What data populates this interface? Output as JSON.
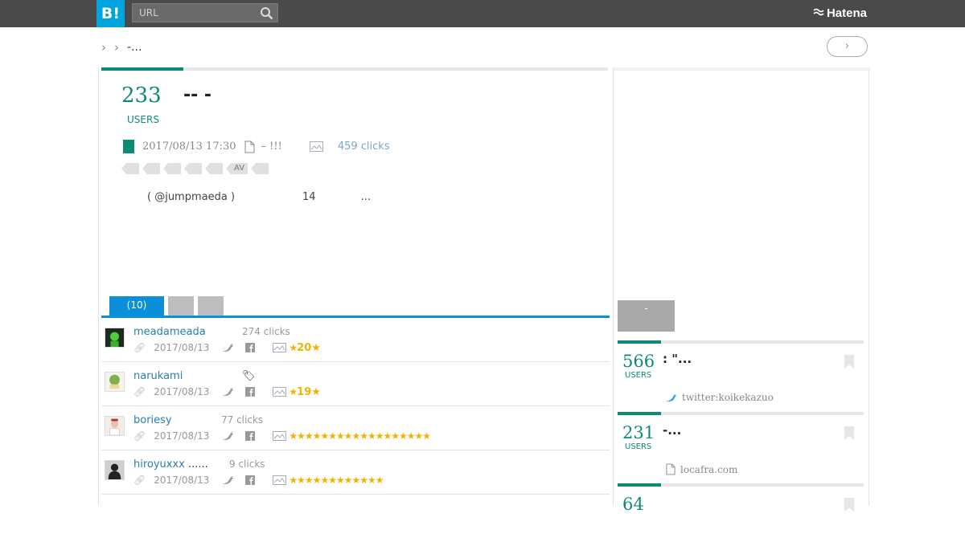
{
  "header": {
    "logo": "B!",
    "url_placeholder": "URL",
    "brand": "Hatena"
  },
  "breadcrumb": {
    "current": "-..."
  },
  "entry": {
    "users_count": "233",
    "users_label": "USERS",
    "title": "-- -",
    "date": "2017/08/13 17:30",
    "source": "– !!!",
    "clicks": "459 clicks",
    "tags": [
      "",
      "",
      "",
      "",
      "",
      "AV",
      ""
    ],
    "summary_author": "( @jumpmaeda )",
    "summary_num": "14",
    "summary_more": "..."
  },
  "tabs": {
    "active_label": "(10)"
  },
  "bookmarks": [
    {
      "user": "meadameada",
      "comment": "",
      "clicks": "274 clicks",
      "date": "2017/08/13",
      "stars": "★",
      "star_count": "20★"
    },
    {
      "user": "narukami",
      "comment": "",
      "clicks": "",
      "date": "2017/08/13",
      "stars": "★",
      "star_count": "19★"
    },
    {
      "user": "boriesy",
      "comment": "",
      "clicks": "77 clicks",
      "date": "2017/08/13",
      "stars": "★★★★★★★★★★★★★★★★★★",
      "star_count": ""
    },
    {
      "user": "hiroyuxxx",
      "comment": "......",
      "clicks": "9 clicks",
      "date": "2017/08/13",
      "stars": "★★★★★★★★★★★★",
      "star_count": ""
    }
  ],
  "sidebar": {
    "gray_button_label": "-",
    "related": [
      {
        "count": "566",
        "users_label": "USERS",
        "title": ": \"...",
        "source": "twitter:koikekazuo"
      },
      {
        "count": "231",
        "users_label": "USERS",
        "title": "-...",
        "source": "locafra.com"
      },
      {
        "count": "64",
        "users_label": "",
        "title": "",
        "source": ""
      }
    ]
  },
  "colors": {
    "accent_green": "#0d8a76",
    "accent_blue": "#0a8fd8",
    "hatena_blue": "#00a4de",
    "topbar": "#4a4a4a",
    "star": "#f0b400"
  }
}
